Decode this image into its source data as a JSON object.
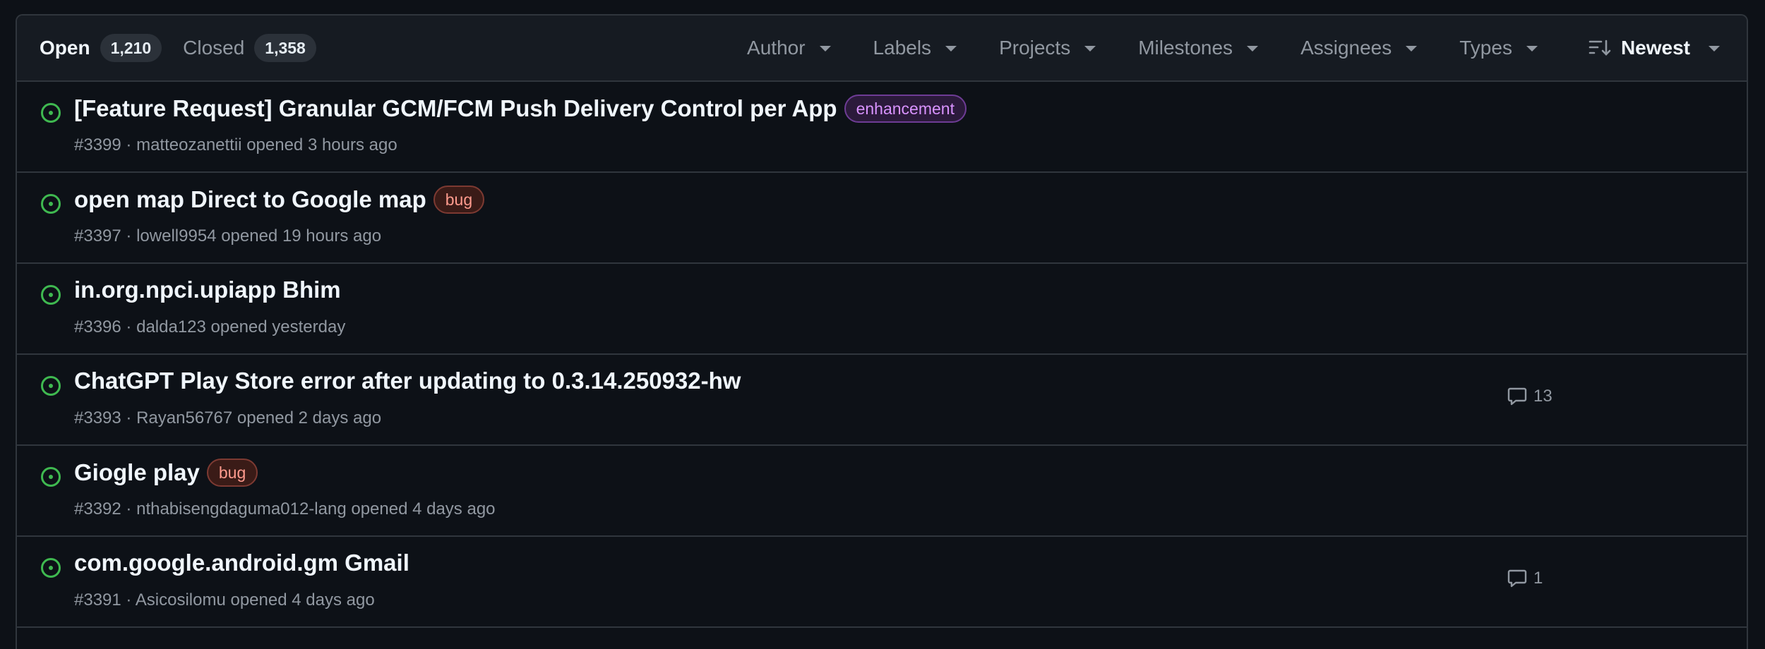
{
  "header": {
    "open": {
      "label": "Open",
      "count": "1,210"
    },
    "closed": {
      "label": "Closed",
      "count": "1,358"
    },
    "filters": [
      {
        "name": "author",
        "label": "Author"
      },
      {
        "name": "labels",
        "label": "Labels"
      },
      {
        "name": "projects",
        "label": "Projects"
      },
      {
        "name": "milestones",
        "label": "Milestones"
      },
      {
        "name": "assignees",
        "label": "Assignees"
      },
      {
        "name": "types",
        "label": "Types"
      }
    ],
    "sort": {
      "label": "Newest",
      "icon": "sort-desc-icon"
    }
  },
  "colors": {
    "open_status": "#3fb950",
    "background": "#0d1117",
    "header_bg": "#161b22",
    "border": "#30363d"
  },
  "issues": [
    {
      "title": "[Feature Request] Granular GCM/FCM Push Delivery Control per App",
      "label": "enhancement",
      "number": "#3399",
      "author": "matteozanettii",
      "opened": "opened 3 hours ago",
      "comments": ""
    },
    {
      "title": "open map Direct to Google map",
      "label": "bug",
      "number": "#3397",
      "author": "lowell9954",
      "opened": "opened 19 hours ago",
      "comments": ""
    },
    {
      "title": "in.org.npci.upiapp Bhim",
      "label": "",
      "number": "#3396",
      "author": "dalda123",
      "opened": "opened yesterday",
      "comments": ""
    },
    {
      "title": "ChatGPT Play Store error after updating to 0.3.14.250932-hw",
      "label": "",
      "number": "#3393",
      "author": "Rayan56767",
      "opened": "opened 2 days ago",
      "comments": "13"
    },
    {
      "title": "Giogle play",
      "label": "bug",
      "number": "#3392",
      "author": "nthabisengdaguma012-lang",
      "opened": "opened 4 days ago",
      "comments": ""
    },
    {
      "title": "com.google.android.gm Gmail",
      "label": "",
      "number": "#3391",
      "author": "Asicosilomu",
      "opened": "opened 4 days ago",
      "comments": "1"
    }
  ]
}
